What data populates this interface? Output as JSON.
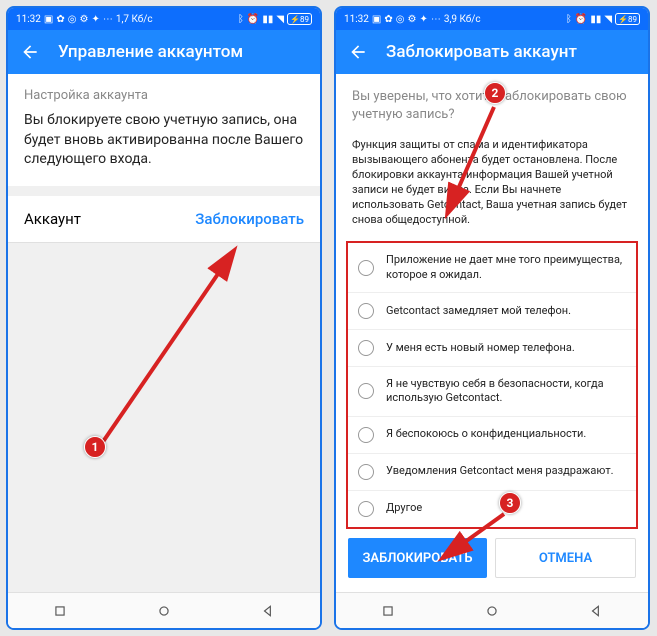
{
  "status": {
    "time": "11:32",
    "net_left": "1,7 Кб/с",
    "net_right": "3,9 Кб/с",
    "battery": "89"
  },
  "left_screen": {
    "title": "Управление аккаунтом",
    "section_header": "Настройка аккаунта",
    "description": "Вы блокируете свою учетную запись, она будет вновь активированна после Вашего следующего входа.",
    "account_label": "Аккаунт",
    "block_action": "Заблокировать"
  },
  "right_screen": {
    "title": "Заблокировать аккаунт",
    "confirm_question": "Вы уверены, что хотите заблокировать свою учетную запись?",
    "confirm_description": "Функция защиты от спама и идентификатора вызывающего абонента будет остановлена. После блокировки аккаунта информация Вашей учетной записи не будет видна. Если Вы начнете использовать Getcontact, Ваша учетная запись будет снова общедоступной.",
    "reasons": [
      "Приложение не дает мне того преимущества, которое я ожидал.",
      "Getcontact замедляет мой телефон.",
      "У меня есть новый номер телефона.",
      "Я не чувствую себя в безопасности, когда использую Getcontact.",
      "Я беспокоюсь о конфиденциальности.",
      "Уведомления Getcontact меня раздражают.",
      "Другое"
    ],
    "btn_block": "ЗАБЛОКИРОВАТЬ",
    "btn_cancel": "ОТМЕНА"
  },
  "steps": {
    "s1": "1",
    "s2": "2",
    "s3": "3"
  }
}
